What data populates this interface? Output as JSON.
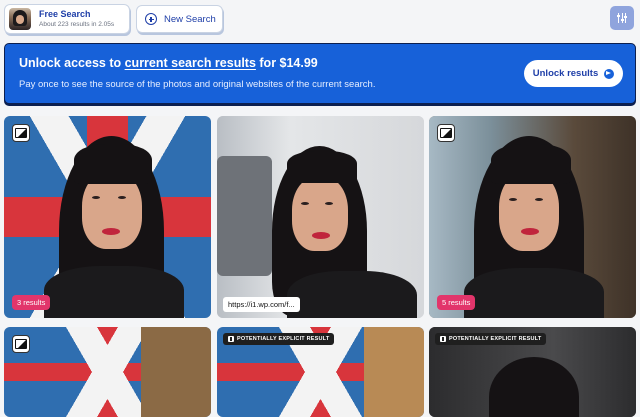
{
  "topbar": {
    "search_chip": {
      "title": "Free Search",
      "subtitle": "About 223 results in 2.05s"
    },
    "new_search_label": "New Search",
    "filter_icon": "sliders-icon"
  },
  "banner": {
    "title_prefix": "Unlock access to ",
    "title_link": "current search results",
    "title_suffix": " for $14.99",
    "description": "Pay once to see the source of the photos and original websites of the current search.",
    "button_label": "Unlock results",
    "colors": {
      "background": "#1761d9",
      "button_text": "#1f3fa8"
    }
  },
  "results": [
    {
      "badge": "3 results",
      "icon": "image-icon"
    },
    {
      "url": "https://i1.wp.com/f..."
    },
    {
      "badge": "5 results",
      "icon": "image-icon"
    },
    {
      "icon": "image-icon"
    },
    {
      "explicit_label": "POTENTIALLY EXPLICIT RESULT"
    },
    {
      "explicit_label": "POTENTIALLY EXPLICIT RESULT"
    }
  ]
}
